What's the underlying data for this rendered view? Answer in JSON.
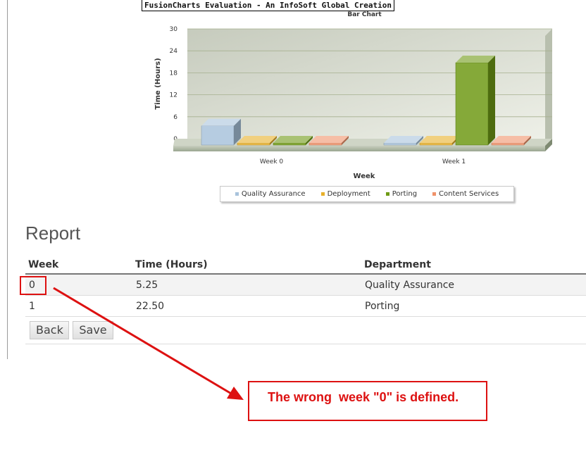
{
  "banner": "FusionCharts Evaluation - An InfoSoft Global Creation",
  "chart_data": {
    "type": "bar",
    "title": "Bar Chart",
    "xlabel": "Week",
    "ylabel": "Time (Hours)",
    "ylim": [
      0,
      30
    ],
    "yticks": [
      "0",
      "6",
      "12",
      "18",
      "24",
      "30"
    ],
    "categories": [
      "Week 0",
      "Week 1"
    ],
    "series": [
      {
        "name": "Quality Assurance",
        "color": "#a9c3dc",
        "values": [
          5.25,
          0
        ]
      },
      {
        "name": "Deployment",
        "color": "#e8b02a",
        "values": [
          0,
          0
        ]
      },
      {
        "name": "Porting",
        "color": "#6f9a16",
        "values": [
          0,
          22.5
        ]
      },
      {
        "name": "Content Services",
        "color": "#f0926a",
        "values": [
          0,
          0
        ]
      }
    ],
    "legend": "bottom",
    "grid": true
  },
  "report": {
    "title": "Report",
    "headers": {
      "week": "Week",
      "time": "Time (Hours)",
      "department": "Department"
    },
    "rows": [
      {
        "week": "0",
        "time": "5.25",
        "department": "Quality Assurance"
      },
      {
        "week": "1",
        "time": "22.50",
        "department": "Porting"
      }
    ]
  },
  "buttons": {
    "back": "Back",
    "save": "Save"
  },
  "annotation": {
    "text": "The wrong  week \"0\" is defined.",
    "color": "#dd1111"
  }
}
